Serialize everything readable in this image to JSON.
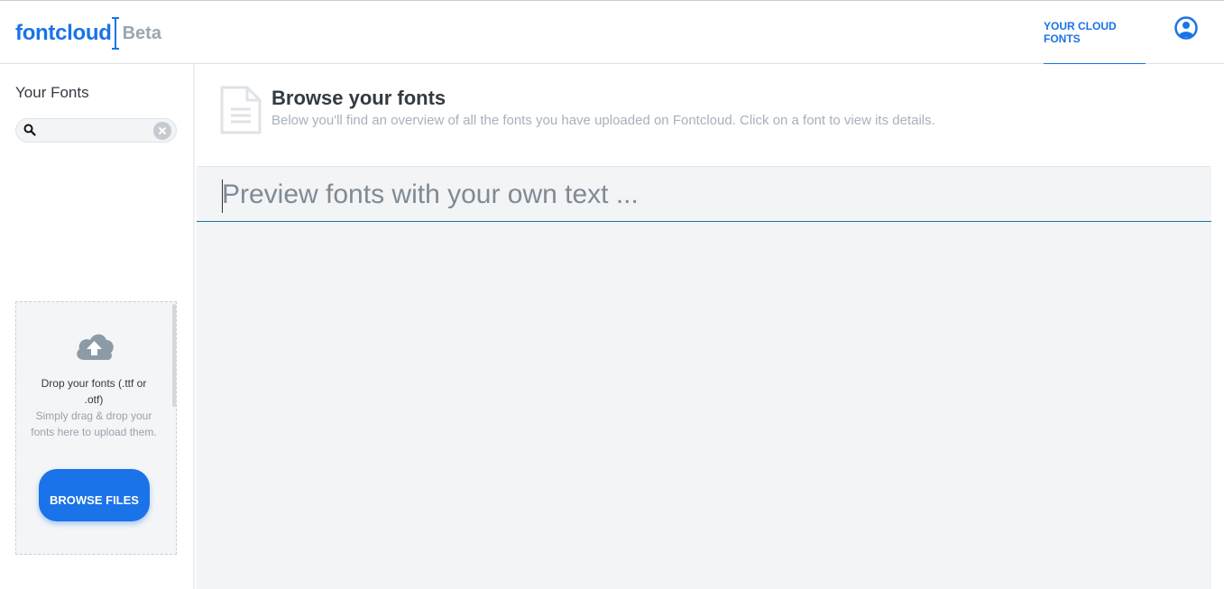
{
  "brand": {
    "name": "fontcloud",
    "badge": "Beta"
  },
  "nav": {
    "link_label": "YOUR CLOUD FONTS",
    "avatar_icon": "user-circle-icon"
  },
  "sidebar": {
    "title": "Your Fonts",
    "search": {
      "value": "",
      "placeholder": ""
    },
    "dropzone": {
      "title": "Drop your fonts (.ttf or .otf)",
      "subtitle": "Simply drag & drop your fonts here to upload them.",
      "button_label": "BROWSE FILES"
    }
  },
  "main": {
    "title": "Browse your fonts",
    "description": "Below you'll find an overview of all the fonts you have uploaded on Fontcloud. Click on a font to view its details.",
    "preview": {
      "placeholder": "Preview fonts with your own text ...",
      "value": ""
    }
  },
  "colors": {
    "accent": "#1a73e8",
    "muted": "#9aa6b2",
    "panel": "#f2f4f5"
  }
}
